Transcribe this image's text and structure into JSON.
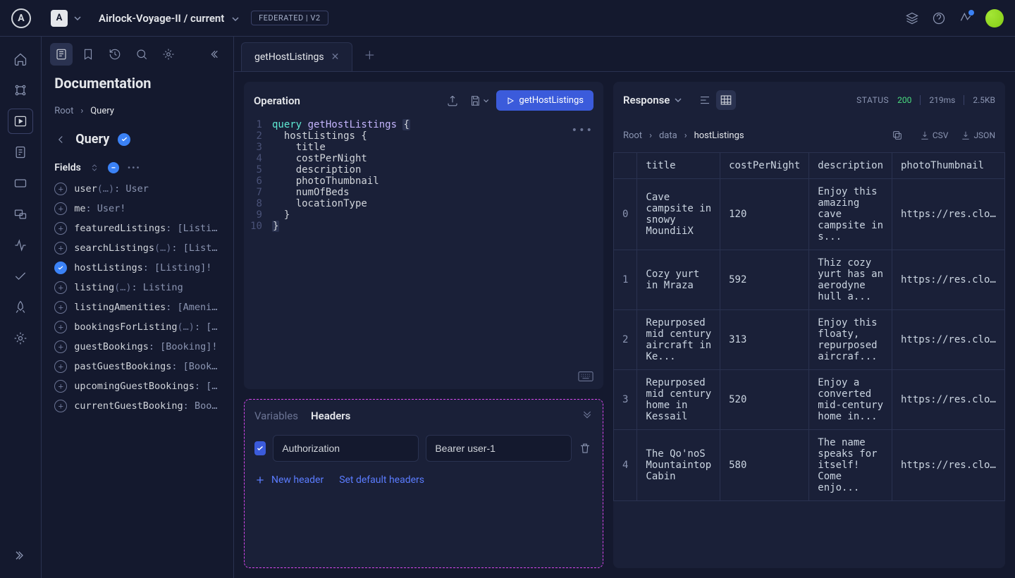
{
  "topbar": {
    "app_letter": "A",
    "graph_name": "Airlock-Voyage-II / current",
    "tag": "FEDERATED | V2"
  },
  "doc": {
    "title": "Documentation",
    "crumb_root": "Root",
    "crumb_current": "Query",
    "query_title": "Query",
    "fields_label": "Fields",
    "fields": [
      {
        "name": "user",
        "args": "(…)",
        "type": "User",
        "checked": false
      },
      {
        "name": "me",
        "args": "",
        "type": "User!",
        "checked": false
      },
      {
        "name": "featuredListings",
        "args": "",
        "type": "[Listi…",
        "checked": false
      },
      {
        "name": "searchListings",
        "args": "(…)",
        "type": "[List…",
        "checked": false
      },
      {
        "name": "hostListings",
        "args": "",
        "type": "[Listing]!",
        "checked": true
      },
      {
        "name": "listing",
        "args": "(…)",
        "type": "Listing",
        "checked": false
      },
      {
        "name": "listingAmenities",
        "args": "",
        "type": "[Ameni…",
        "checked": false
      },
      {
        "name": "bookingsForListing",
        "args": "(…)",
        "type": "[…",
        "checked": false
      },
      {
        "name": "guestBookings",
        "args": "",
        "type": "[Booking]!",
        "checked": false
      },
      {
        "name": "pastGuestBookings",
        "args": "",
        "type": "[Book…",
        "checked": false
      },
      {
        "name": "upcomingGuestBookings",
        "args": "",
        "type": "[…",
        "checked": false
      },
      {
        "name": "currentGuestBooking",
        "args": "",
        "type": "Boo…",
        "checked": false
      }
    ]
  },
  "tabs": {
    "active_tab": "getHostListings"
  },
  "operation": {
    "title": "Operation",
    "run_label": "getHostListings",
    "code": {
      "keyword": "query",
      "fn": "getHostListings",
      "root": "hostListings",
      "fields": [
        "title",
        "costPerNight",
        "description",
        "photoThumbnail",
        "numOfBeds",
        "locationType"
      ]
    }
  },
  "headers_panel": {
    "tab_variables": "Variables",
    "tab_headers": "Headers",
    "row_key": "Authorization",
    "row_value": "Bearer user-1",
    "new_header": "New header",
    "set_default": "Set default headers"
  },
  "response": {
    "title": "Response",
    "status_label": "STATUS",
    "status_code": "200",
    "time": "219ms",
    "size": "2.5KB",
    "crumb_root": "Root",
    "crumb_data": "data",
    "crumb_leaf": "hostListings",
    "export_csv": "CSV",
    "export_json": "JSON",
    "columns": [
      "title",
      "costPerNight",
      "description",
      "photoThumbnail"
    ],
    "rows": [
      {
        "idx": "0",
        "title": "Cave campsite in snowy MoundiiX",
        "costPerNight": "120",
        "description": "Enjoy this amazing cave campsite in s...",
        "photoThumbnail": "https://res.cloudinary.c"
      },
      {
        "idx": "1",
        "title": "Cozy yurt in Mraza",
        "costPerNight": "592",
        "description": "Thiz cozy yurt has an aerodyne hull a...",
        "photoThumbnail": "https://res.cloudinary.c"
      },
      {
        "idx": "2",
        "title": "Repurposed mid century aircraft in Ke...",
        "costPerNight": "313",
        "description": "Enjoy this floaty, repurposed aircraf...",
        "photoThumbnail": "https://res.cloudinary.c"
      },
      {
        "idx": "3",
        "title": "Repurposed mid century home in Kessail",
        "costPerNight": "520",
        "description": "Enjoy a converted mid-century home in...",
        "photoThumbnail": "https://res.cloudinary.c"
      },
      {
        "idx": "4",
        "title": "The Qo'noS Mountaintop Cabin",
        "costPerNight": "580",
        "description": "The name speaks for itself! Come enjo...",
        "photoThumbnail": "https://res.cloudinary.c"
      }
    ]
  }
}
